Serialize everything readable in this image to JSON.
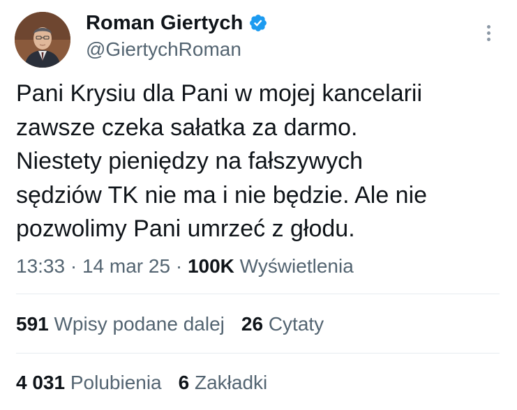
{
  "author": {
    "display_name": "Roman Giertych",
    "handle": "@GiertychRoman",
    "verified": true,
    "verified_color": "#1d9bf0"
  },
  "tweet": {
    "lines": [
      "Pani Krysiu dla Pani w mojej kancelarii",
      "zawsze czeka sałatka za darmo.",
      "Niestety pieniędzy na fałszywych",
      "sędziów TK nie ma i nie będzie. Ale nie",
      "pozwolimy Pani umrzeć z głodu."
    ]
  },
  "meta": {
    "time": "13:33",
    "separator": "·",
    "date": "14 mar 25",
    "views_count": "100K",
    "views_label": "Wyświetlenia"
  },
  "stats": {
    "retweets_count": "591",
    "retweets_label": "Wpisy podane dalej",
    "quotes_count": "26",
    "quotes_label": "Cytaty",
    "likes_count": "4 031",
    "likes_label": "Polubienia",
    "bookmarks_count": "6",
    "bookmarks_label": "Zakładki"
  },
  "icons": {
    "more": "more-vertical-icon",
    "verified": "verified-badge-icon"
  }
}
